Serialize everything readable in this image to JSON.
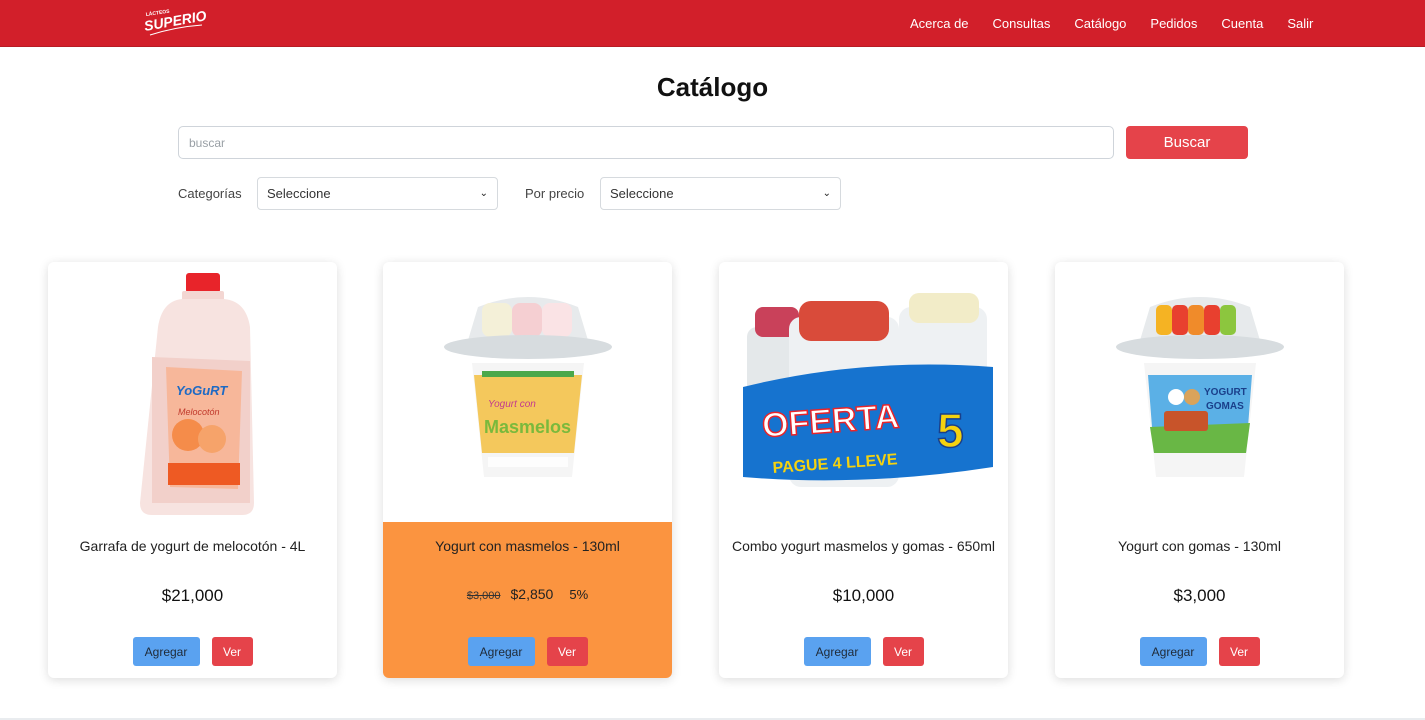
{
  "brand": {
    "logo_text": "SUPERIOR",
    "logo_small": "LÁCTEOS",
    "color": "#d21f2a"
  },
  "nav": [
    {
      "label": "Acerca de"
    },
    {
      "label": "Consultas"
    },
    {
      "label": "Catálogo"
    },
    {
      "label": "Pedidos"
    },
    {
      "label": "Cuenta"
    },
    {
      "label": "Salir"
    }
  ],
  "page": {
    "title": "Catálogo"
  },
  "search": {
    "placeholder": "buscar",
    "value": "",
    "button_label": "Buscar"
  },
  "filters": {
    "category": {
      "label": "Categorías",
      "selected": "Seleccione"
    },
    "price": {
      "label": "Por precio",
      "selected": "Seleccione"
    }
  },
  "products": [
    {
      "name": "Garrafa de yogurt de melocotón - 4L",
      "price": "$21,000",
      "add_label": "Agregar",
      "view_label": "Ver",
      "image_icon": "peach-yogurt-jug"
    },
    {
      "name": "Yogurt con masmelos - 130ml",
      "old_price": "$3,000",
      "price": "$2,850",
      "discount": "5%",
      "add_label": "Agregar",
      "view_label": "Ver",
      "highlight": "#fb9440",
      "image_icon": "marshmallow-yogurt-cup"
    },
    {
      "name": "Combo yogurt masmelos y gomas - 650ml",
      "price": "$10,000",
      "add_label": "Agregar",
      "view_label": "Ver",
      "image_icon": "yogurt-combo-pack",
      "image_text": [
        "OFERTA",
        "5",
        "PAGUE 4 LLEVE"
      ]
    },
    {
      "name": "Yogurt con gomas - 130ml",
      "price": "$3,000",
      "add_label": "Agregar",
      "view_label": "Ver",
      "image_icon": "gummy-yogurt-cup"
    }
  ]
}
